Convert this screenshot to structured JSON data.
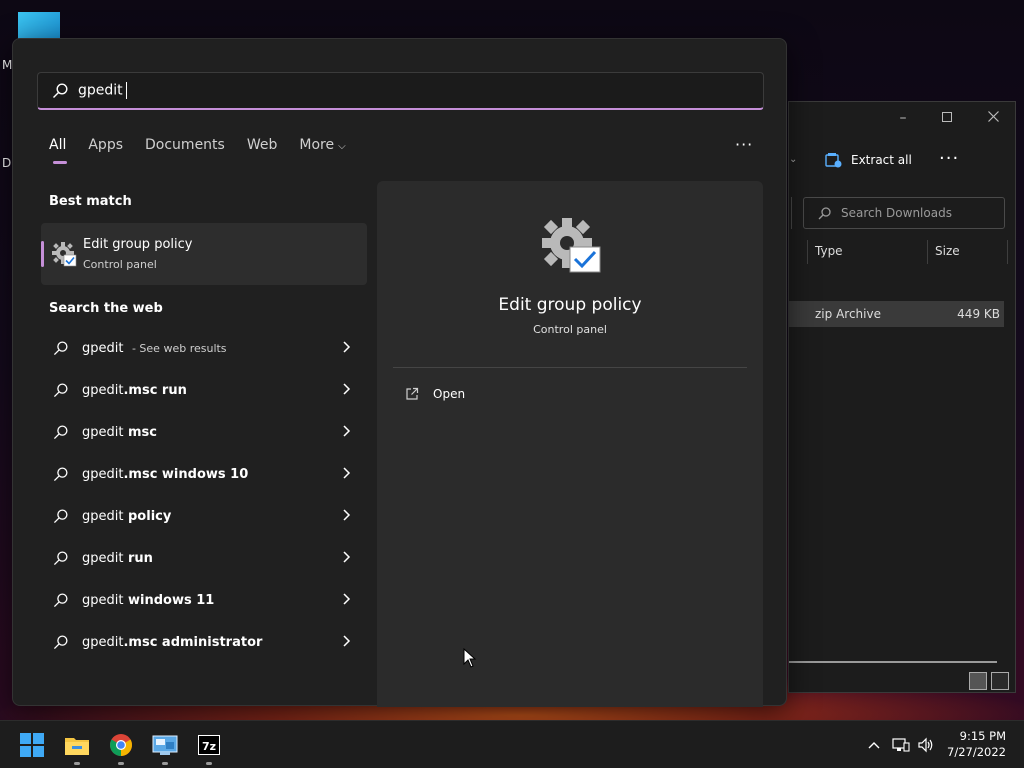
{
  "desktop": {
    "label_m": "M",
    "label_d": "D"
  },
  "explorer": {
    "extract_all": "Extract all",
    "more": "···",
    "search_placeholder": "Search Downloads",
    "columns": {
      "type": "Type",
      "size": "Size"
    },
    "file": {
      "type": "zip Archive",
      "size": "449 KB"
    }
  },
  "search": {
    "query": "gpedit",
    "tabs": [
      {
        "label": "All"
      },
      {
        "label": "Apps"
      },
      {
        "label": "Documents"
      },
      {
        "label": "Web"
      },
      {
        "label": "More"
      }
    ],
    "more_options": "···",
    "best_match_heading": "Best match",
    "best_match": {
      "title": "Edit group policy",
      "subtitle": "Control panel"
    },
    "web_heading": "Search the web",
    "web_results": [
      {
        "prefix": "gpedit",
        "bold": "",
        "sub": " - See web results"
      },
      {
        "prefix": "gpedit",
        "bold": ".msc run",
        "sub": ""
      },
      {
        "prefix": "gpedit",
        "bold": " msc",
        "sub": ""
      },
      {
        "prefix": "gpedit",
        "bold": ".msc windows 10",
        "sub": ""
      },
      {
        "prefix": "gpedit",
        "bold": " policy",
        "sub": ""
      },
      {
        "prefix": "gpedit",
        "bold": " run",
        "sub": ""
      },
      {
        "prefix": "gpedit",
        "bold": " windows 11",
        "sub": ""
      },
      {
        "prefix": "gpedit",
        "bold": ".msc administrator",
        "sub": ""
      }
    ],
    "detail": {
      "title": "Edit group policy",
      "subtitle": "Control panel",
      "action_open": "Open"
    }
  },
  "taskbar": {
    "apps": [
      "start-icon",
      "file-explorer-icon",
      "chrome-icon",
      "control-panel-icon",
      "7zip-icon"
    ],
    "sevenzip_label": "7z",
    "clock": {
      "time": "9:15 PM",
      "date": "7/27/2022"
    }
  },
  "colors": {
    "accent": "#c58fd8",
    "panel_bg": "#202020",
    "detail_bg": "#2b2b2b"
  }
}
